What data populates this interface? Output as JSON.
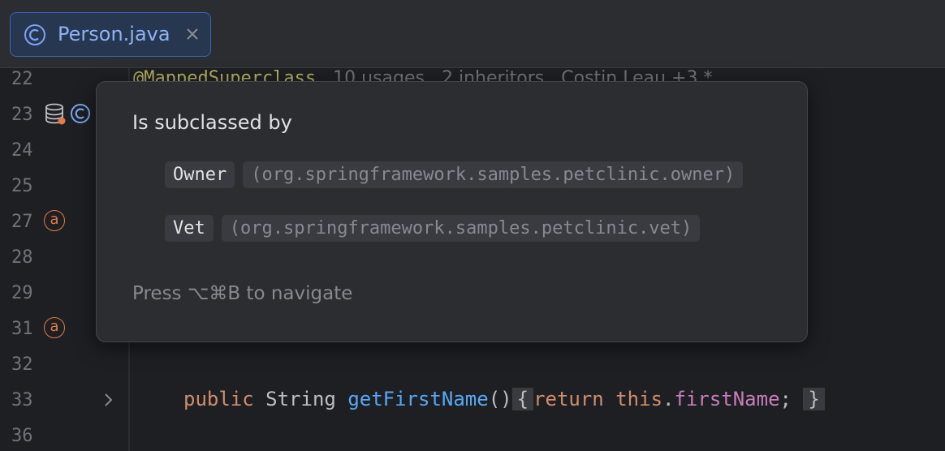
{
  "tab": {
    "label": "Person.java",
    "icon": "class-icon",
    "accent": "#7aa2f7"
  },
  "editor": {
    "hint": {
      "annotation": "@MappedSuperclass",
      "usages": "10 usages",
      "inheritors": "2 inheritors",
      "author": "Costin Leau +3 *"
    },
    "line_numbers": [
      "22",
      "23",
      "24",
      "25",
      "27",
      "28",
      "29",
      "31",
      "32",
      "33",
      "36"
    ],
    "code_33": {
      "kw_public": "public",
      "type": "String",
      "fn": "getFirstName",
      "parens": "()",
      "open_brace": "{",
      "kw_return": "return",
      "kw_this": "this",
      "dot": ".",
      "field": "firstName",
      "semi": ";",
      "close_brace": "}"
    }
  },
  "popup": {
    "title": "Is subclassed by",
    "subclasses": [
      {
        "name": "Owner",
        "package": "(org.springframework.samples.petclinic.owner)"
      },
      {
        "name": "Vet",
        "package": "(org.springframework.samples.petclinic.vet)"
      }
    ],
    "footer": "Press ⌥⌘B to navigate"
  },
  "gutter": {
    "annotation_badge": "a"
  }
}
